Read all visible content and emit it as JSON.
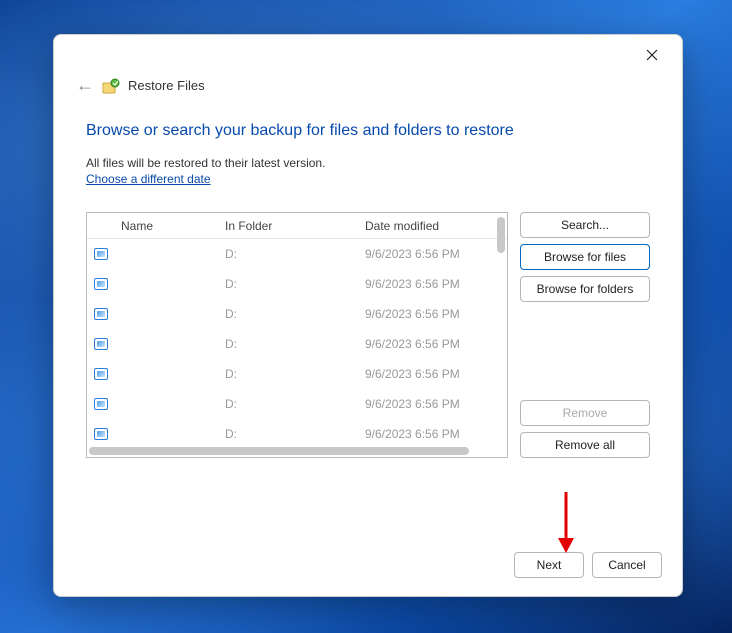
{
  "window": {
    "title": "Restore Files"
  },
  "heading": "Browse or search your backup for files and folders to restore",
  "subtext": "All files will be restored to their latest version.",
  "link_text": "Choose a different date",
  "columns": {
    "name": "Name",
    "folder": "In Folder",
    "date": "Date modified"
  },
  "rows": [
    {
      "folder": "D:",
      "date": "9/6/2023 6:56 PM"
    },
    {
      "folder": "D:",
      "date": "9/6/2023 6:56 PM"
    },
    {
      "folder": "D:",
      "date": "9/6/2023 6:56 PM"
    },
    {
      "folder": "D:",
      "date": "9/6/2023 6:56 PM"
    },
    {
      "folder": "D:",
      "date": "9/6/2023 6:56 PM"
    },
    {
      "folder": "D:",
      "date": "9/6/2023 6:56 PM"
    },
    {
      "folder": "D:",
      "date": "9/6/2023 6:56 PM"
    }
  ],
  "buttons": {
    "search": "Search...",
    "browse_files": "Browse for files",
    "browse_folders": "Browse for folders",
    "remove": "Remove",
    "remove_all": "Remove all",
    "next": "Next",
    "cancel": "Cancel"
  }
}
